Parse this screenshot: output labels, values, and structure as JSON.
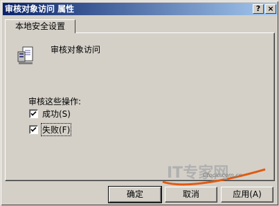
{
  "window": {
    "title": "审核对象访问 属性"
  },
  "titlebar_buttons": {
    "help": "?",
    "close": "×"
  },
  "tab": {
    "label": "本地安全设置"
  },
  "policy": {
    "name": "审核对象访问"
  },
  "audit": {
    "section_label": "审核这些操作:",
    "options": [
      {
        "label": "成功(S)",
        "checked": true
      },
      {
        "label": "失败(F)",
        "checked": true
      }
    ]
  },
  "watermark": {
    "brand": "IT专家网",
    "url": "Ctocio.com.cn"
  },
  "buttons": {
    "ok": "确定",
    "cancel": "取消",
    "apply": "应用(A)"
  }
}
